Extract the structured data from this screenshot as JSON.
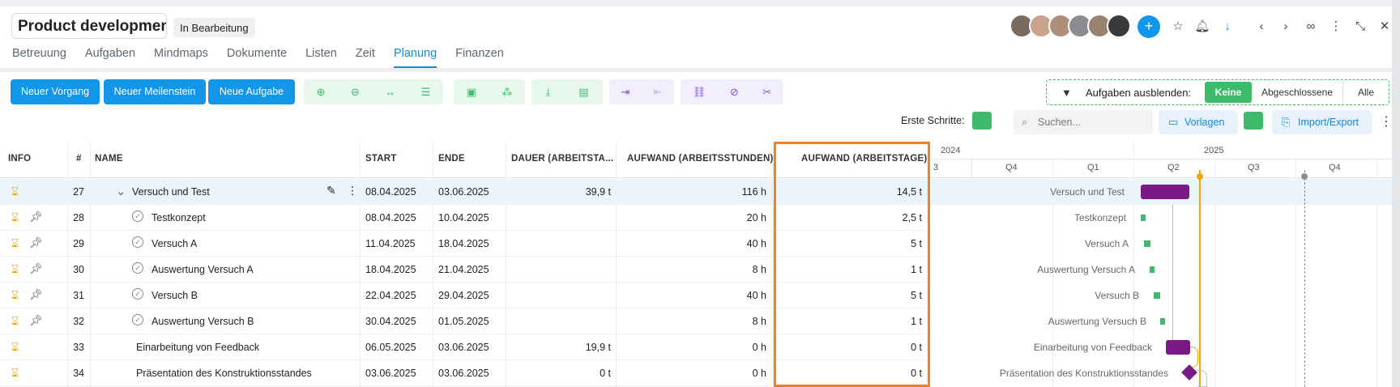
{
  "project": {
    "title": "Product development D",
    "status": "In Bearbeitung"
  },
  "tabs": [
    "Betreuung",
    "Aufgaben",
    "Mindmaps",
    "Dokumente",
    "Listen",
    "Zeit",
    "Planung",
    "Finanzen"
  ],
  "active_tab": "Planung",
  "header_icons": [
    "add-icon",
    "star-icon",
    "bell-icon",
    "arrow-down-icon",
    "chevron-left-icon",
    "chevron-right-icon",
    "link-icon",
    "kebab-icon",
    "collapse-icon"
  ],
  "toolbar": {
    "new_process": "Neuer Vorgang",
    "new_milestone": "Neuer Meilenstein",
    "new_task": "Neue Aufgabe"
  },
  "filter": {
    "label": "Aufgaben ausblenden:",
    "options": [
      "Keine",
      "Abgeschlossene",
      "Alle"
    ],
    "selected": "Keine"
  },
  "first_steps": "Erste Schritte:",
  "search": {
    "placeholder": "Suchen..."
  },
  "templates": "Vorlagen",
  "import_export": "Import/Export",
  "columns": {
    "info": "INFO",
    "num": "#",
    "name": "NAME",
    "start": "START",
    "end": "ENDE",
    "duration": "DAUER (ARBEITSTA...",
    "effort_hours": "AUFWAND (ARBEITSSTUNDEN)",
    "effort_days": "AUFWAND (ARBEITSTAGE)"
  },
  "rows": [
    {
      "num": "27",
      "name": "Versuch und Test",
      "start": "08.04.2025",
      "end": "03.06.2025",
      "duration": "39,9 t",
      "hours": "116 h",
      "days": "14,5 t"
    },
    {
      "num": "28",
      "name": "Testkonzept",
      "start": "08.04.2025",
      "end": "10.04.2025",
      "duration": "",
      "hours": "20 h",
      "days": "2,5 t"
    },
    {
      "num": "29",
      "name": "Versuch A",
      "start": "11.04.2025",
      "end": "18.04.2025",
      "duration": "",
      "hours": "40 h",
      "days": "5 t"
    },
    {
      "num": "30",
      "name": "Auswertung Versuch A",
      "start": "18.04.2025",
      "end": "21.04.2025",
      "duration": "",
      "hours": "8 h",
      "days": "1 t"
    },
    {
      "num": "31",
      "name": "Versuch B",
      "start": "22.04.2025",
      "end": "29.04.2025",
      "duration": "",
      "hours": "40 h",
      "days": "5 t"
    },
    {
      "num": "32",
      "name": "Auswertung Versuch B",
      "start": "30.04.2025",
      "end": "01.05.2025",
      "duration": "",
      "hours": "8 h",
      "days": "1 t"
    },
    {
      "num": "33",
      "name": "Einarbeitung von Feedback",
      "start": "06.05.2025",
      "end": "03.06.2025",
      "duration": "19,9 t",
      "hours": "0 h",
      "days": "0 t"
    },
    {
      "num": "34",
      "name": "Präsentation des Konstruktionsstandes",
      "start": "03.06.2025",
      "end": "03.06.2025",
      "duration": "0 t",
      "hours": "0 h",
      "days": "0 t"
    }
  ],
  "gantt": {
    "years": [
      "2024",
      "2025"
    ],
    "quarters": [
      "3",
      "Q4",
      "Q1",
      "Q2",
      "Q3",
      "Q4"
    ]
  },
  "colors": {
    "accent": "#1296ea",
    "green": "#3dbb6a",
    "purple_bar": "#7b1a86",
    "highlight": "#f08220",
    "hourglass": "#f2a500"
  }
}
